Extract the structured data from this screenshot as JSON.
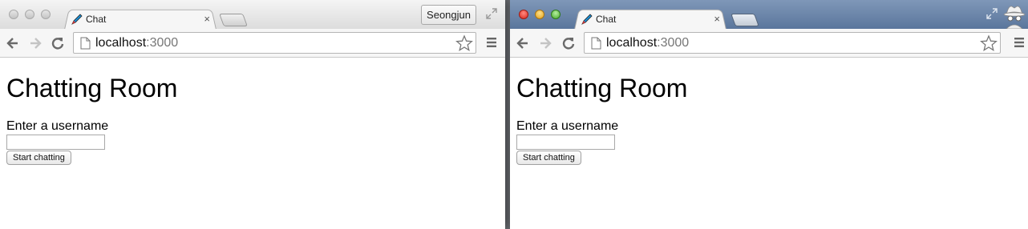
{
  "windows": [
    {
      "tab_title": "Chat",
      "tab_close": "×",
      "profile_name": "Seongjun",
      "url_host": "localhost",
      "url_port": ":3000",
      "page_heading": "Chatting Room",
      "username_label": "Enter a username",
      "username_value": "",
      "start_button": "Start chatting"
    },
    {
      "tab_title": "Chat",
      "tab_close": "×",
      "url_host": "localhost",
      "url_port": ":3000",
      "page_heading": "Chatting Room",
      "username_label": "Enter a username",
      "username_value": "",
      "start_button": "Start chatting"
    }
  ],
  "icons": [
    "back-arrow-icon",
    "forward-arrow-icon",
    "reload-icon",
    "page-icon",
    "star-icon",
    "menu-icon",
    "fullscreen-icon",
    "incognito-icon",
    "favicon-pencil-icon"
  ],
  "colors": {
    "incognito_frame": "#5a769c",
    "normal_frame": "#dcdcdc"
  }
}
